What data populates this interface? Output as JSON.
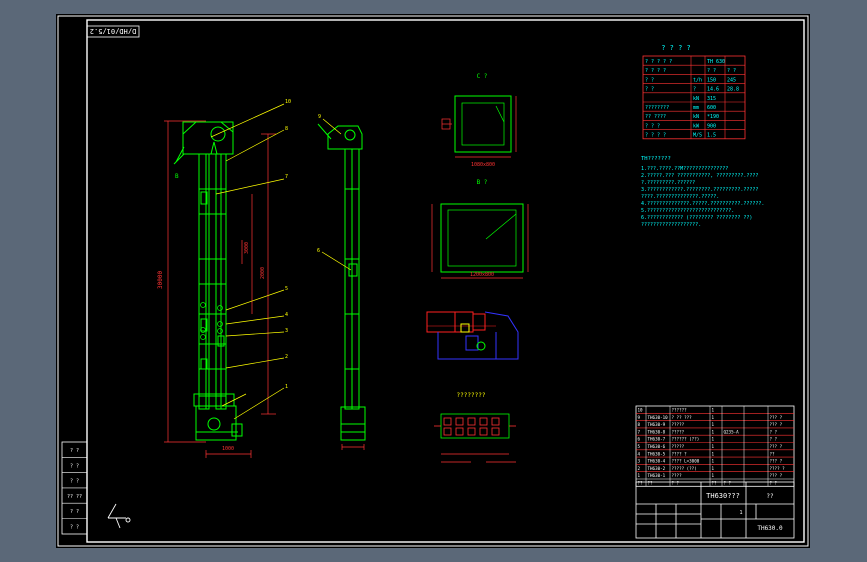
{
  "drawing": {
    "stamp": "D/HD/01/5.2",
    "views": {
      "section_c_label": "C ?",
      "section_b_label": "B ?",
      "bolt_view_label": "????????"
    },
    "balloons": [
      "1",
      "2",
      "3",
      "4",
      "5",
      "6",
      "7",
      "8",
      "9",
      "10"
    ],
    "side_label_b": "B",
    "dimensions": {
      "overall_height": "30000",
      "base_width": "1000",
      "lower_section": "2000",
      "upper_section": "3000",
      "flange_c": "1080x800",
      "flange_b": "1200x800"
    }
  },
  "spec_table": {
    "title": "? ? ? ?",
    "rows": [
      {
        "name": "? ? ? ? ?",
        "unit": "",
        "v1": "TH 630",
        "v2": ""
      },
      {
        "name": "? ? ? ?",
        "unit": "",
        "v1": "? ?",
        "v2": "? ?"
      },
      {
        "name": "? ?",
        "unit": "t/h",
        "v1": "150",
        "v2": "245"
      },
      {
        "name": "? ?",
        "unit": "?",
        "v1": "14.6",
        "v2": "28.8"
      },
      {
        "name": "",
        "unit": "kN",
        "v1": "315",
        "v2": ""
      },
      {
        "name": "????????",
        "unit": "mm",
        "v1": "600",
        "v2": ""
      },
      {
        "name": "?? ????",
        "unit": "kN",
        "v1": "*190",
        "v2": ""
      },
      {
        "name": "? ? ?",
        "unit": "kW",
        "v1": "900",
        "v2": ""
      },
      {
        "name": "? ? ? ?",
        "unit": "M/S",
        "v1": "1.5",
        "v2": ""
      }
    ]
  },
  "notes": {
    "title": "TH???????",
    "lines": [
      "1.???.????.??M???????????????",
      "2.?????.??? ???????????, ?????????.????",
      "  ?.?????????.??????",
      "3.????????????.????????.?????????.?????",
      "  ????.??????????????.?????.",
      "4.??????????????.?????.??????????.??????.",
      "5.????????????????????????????.",
      "6.???????????? (???????? ???????? ??)",
      "  ???????????????????."
    ]
  },
  "parts_list": [
    {
      "no": "10",
      "code": "",
      "name": "??????",
      "qty": "1",
      "mat": "",
      "note": ""
    },
    {
      "no": "9",
      "code": "TH630-10",
      "name": "? ?? ???",
      "qty": "1",
      "mat": "",
      "note": "??? ?"
    },
    {
      "no": "8",
      "code": "TH630-9",
      "name": "?????",
      "qty": "1",
      "mat": "",
      "note": "??? ?"
    },
    {
      "no": "7",
      "code": "TH630-8",
      "name": "?????",
      "qty": "1",
      "mat": "Q235-A",
      "note": "? ?"
    },
    {
      "no": "6",
      "code": "TH630-7",
      "name": "?????? (??)",
      "qty": "1",
      "mat": "",
      "note": "? ?"
    },
    {
      "no": "5",
      "code": "TH630-6",
      "name": "?????",
      "qty": "1",
      "mat": "",
      "note": "??? ?"
    },
    {
      "no": "4",
      "code": "TH630-5",
      "name": "???? ?",
      "qty": "1",
      "mat": "",
      "note": "??"
    },
    {
      "no": "3",
      "code": "TH630-4",
      "name": "???? L=3000",
      "qty": "1",
      "mat": "",
      "note": "??? ?"
    },
    {
      "no": "2",
      "code": "TH630-2",
      "name": "????? (??)",
      "qty": "1",
      "mat": "",
      "note": "???? ?"
    },
    {
      "no": "1",
      "code": "TH630-1",
      "name": "????",
      "qty": "1",
      "mat": "",
      "note": "??? ?"
    },
    {
      "no": "??",
      "code": "??",
      "name": "? ?",
      "qty": "??",
      "mat": "? ?",
      "note": "? ?"
    }
  ],
  "title_block": {
    "name": "TH630???",
    "scale_label": "??",
    "drawing_no": "TH630.0",
    "sheet": "1"
  },
  "revision_block": {
    "rows": [
      "? ?",
      "? ?",
      "? ?",
      "?? ??",
      "? ?",
      "? ?"
    ]
  },
  "colors": {
    "background": "#000000",
    "frame": "#ffffff",
    "machine": "#00ff00",
    "dimension": "#ff3333",
    "leader": "#ffff00",
    "spec": "#00ffff",
    "notes": "#00ffff",
    "detail_blue": "#3333ff",
    "detail_red": "#ff2020"
  }
}
